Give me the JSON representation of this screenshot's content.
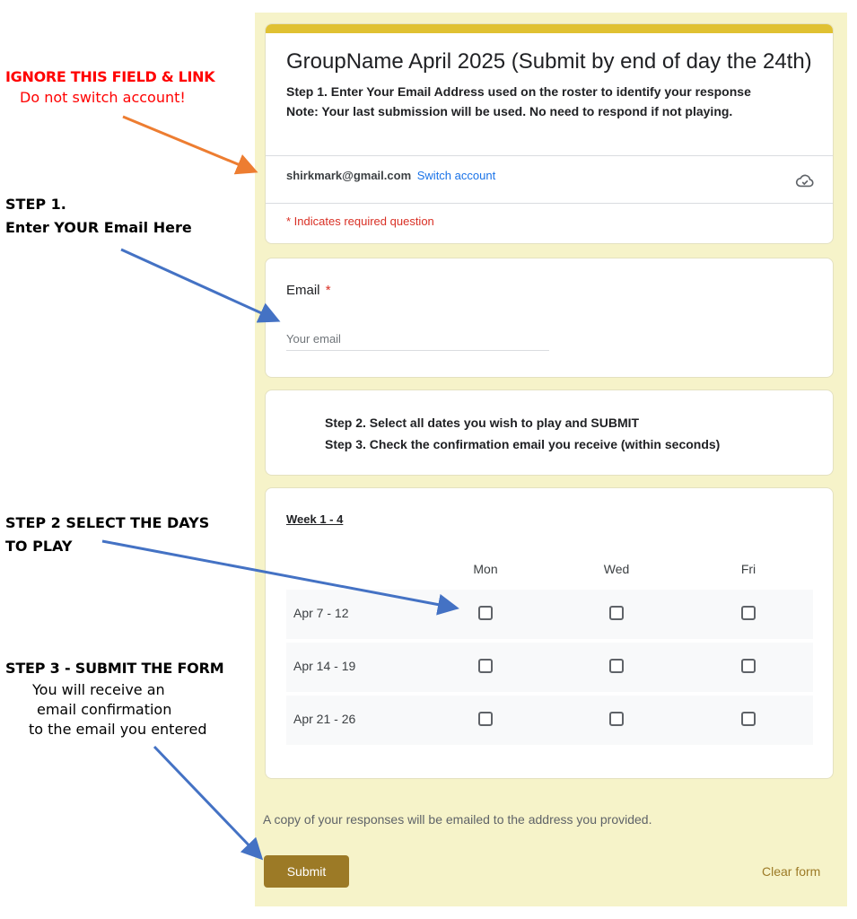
{
  "annotations": {
    "ignore_title": "IGNORE THIS FIELD & LINK",
    "ignore_sub": "Do not switch account!",
    "step1_line1": "STEP 1.",
    "step1_line2": "Enter YOUR Email Here",
    "step2_line1": "STEP 2 SELECT THE  DAYS",
    "step2_line2": "TO PLAY",
    "step3_title": "STEP 3 - SUBMIT THE FORM",
    "step3_line1": "You will receive an",
    "step3_line2": "email confirmation",
    "step3_line3": "to the email you entered",
    "colors": {
      "red": "#ff0000",
      "orange_arrow": "#ed7d31",
      "blue_arrow": "#4472c4"
    }
  },
  "form": {
    "accent": "#e0c132",
    "background": "#f6f3c9",
    "title": "GroupName April 2025 (Submit by end of day the 24th)",
    "description_line1": "Step 1. Enter Your Email Address used on the roster to identify your response",
    "description_line2": "Note: Your last submission will be used.  No need to respond if not playing.",
    "account_email": "shirkmark@gmail.com",
    "switch_account": "Switch account",
    "cloud_icon": "cloud-saved-icon",
    "required_note": "* Indicates required question",
    "email_question": {
      "label": "Email",
      "required_mark": "*",
      "placeholder": "Your email",
      "value": ""
    },
    "steps_text": {
      "line1": "Step 2. Select all dates you wish to play and SUBMIT",
      "line2": "Step 3. Check the confirmation email you receive (within seconds)"
    },
    "grid": {
      "title": "Week 1 - 4",
      "columns": [
        "Mon",
        "Wed",
        "Fri"
      ],
      "rows": [
        {
          "label": "Apr 7 - 12",
          "checked": [
            false,
            false,
            false
          ]
        },
        {
          "label": "Apr 14 - 19",
          "checked": [
            false,
            false,
            false
          ]
        },
        {
          "label": "Apr 21 - 26",
          "checked": [
            false,
            false,
            false
          ]
        }
      ]
    },
    "copy_note": "A copy of your responses will be emailed to the address you provided.",
    "submit_label": "Submit",
    "clear_label": "Clear form",
    "submit_color": "#9c7a26"
  }
}
